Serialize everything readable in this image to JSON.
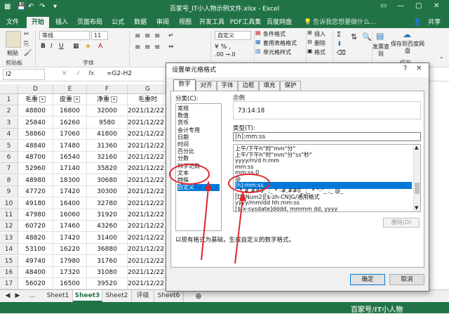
{
  "titlebar": {
    "title": "百家号_IT小人物示例文件.xlsx - Excel"
  },
  "ribbon_tabs": [
    "文件",
    "开始",
    "插入",
    "页面布局",
    "公式",
    "数据",
    "审阅",
    "视图",
    "开发工具",
    "PDF工具集",
    "百度网盘"
  ],
  "ribbon_search": "告诉我您想要做什么...",
  "ribbon_share": "共享",
  "ribbon": {
    "paste": "粘贴",
    "clipboard": "剪贴板",
    "font_name": "等线",
    "font_size": "11",
    "font_group": "字体",
    "number_format": "自定义",
    "cond_format": "条件格式",
    "table_format": "套用表格格式",
    "cell_style": "单元格样式",
    "insert": "插入",
    "delete": "删除",
    "format": "格式",
    "invoice": "发票查验",
    "save_baidu": "保存到百度网盘",
    "save_group": "保存"
  },
  "formula_bar": {
    "namebox": "I2",
    "formula": "=G2-H2"
  },
  "grid": {
    "columns": [
      "D",
      "E",
      "F",
      "G"
    ],
    "headers": [
      "毛重",
      "皮重",
      "净重",
      "毛重时"
    ],
    "rows": [
      {
        "n": "1"
      },
      {
        "n": "2",
        "d": "48800",
        "e": "16800",
        "f": "32000",
        "g": "2021/12/22 0"
      },
      {
        "n": "3",
        "d": "25840",
        "e": "16260",
        "f": "9580",
        "g": "2021/12/22 0"
      },
      {
        "n": "4",
        "d": "58860",
        "e": "17060",
        "f": "41800",
        "g": "2021/12/22 0"
      },
      {
        "n": "5",
        "d": "48840",
        "e": "17480",
        "f": "31360",
        "g": "2021/12/22 0"
      },
      {
        "n": "6",
        "d": "48700",
        "e": "16540",
        "f": "32160",
        "g": "2021/12/22 0"
      },
      {
        "n": "7",
        "d": "52960",
        "e": "17140",
        "f": "35820",
        "g": "2021/12/22 0"
      },
      {
        "n": "8",
        "d": "48980",
        "e": "18300",
        "f": "30680",
        "g": "2021/12/22 0"
      },
      {
        "n": "9",
        "d": "47720",
        "e": "17420",
        "f": "30300",
        "g": "2021/12/22 0"
      },
      {
        "n": "10",
        "d": "49180",
        "e": "16400",
        "f": "32780",
        "g": "2021/12/22 0"
      },
      {
        "n": "11",
        "d": "47980",
        "e": "16060",
        "f": "31920",
        "g": "2021/12/22 0"
      },
      {
        "n": "12",
        "d": "60720",
        "e": "17460",
        "f": "43260",
        "g": "2021/12/22 0"
      },
      {
        "n": "13",
        "d": "48820",
        "e": "17420",
        "f": "31400",
        "g": "2021/12/22 0"
      },
      {
        "n": "14",
        "d": "53100",
        "e": "16220",
        "f": "36880",
        "g": "2021/12/22 0"
      },
      {
        "n": "15",
        "d": "49740",
        "e": "17980",
        "f": "31760",
        "g": "2021/12/22 0"
      },
      {
        "n": "16",
        "d": "48400",
        "e": "17320",
        "f": "31080",
        "g": "2021/12/22 0"
      },
      {
        "n": "17",
        "d": "56020",
        "e": "16500",
        "f": "39520",
        "g": "2021/12/22 0"
      }
    ]
  },
  "sheet_tabs": [
    "Sheet1",
    "Sheet3",
    "Sheet2",
    "评级",
    "Sheet6"
  ],
  "sheet_tab_active": "Sheet3",
  "dialog": {
    "title": "设置单元格格式",
    "tabs": [
      "数字",
      "对齐",
      "字体",
      "边框",
      "填充",
      "保护"
    ],
    "category_label": "分类(C):",
    "categories": [
      "常规",
      "数值",
      "货币",
      "会计专用",
      "日期",
      "时间",
      "百分比",
      "分数",
      "科学记数",
      "文本",
      "特殊",
      "自定义"
    ],
    "selected_category": "自定义",
    "sample_label": "示例",
    "sample_value": "73:14:18",
    "type_label": "类型(T):",
    "type_value": "[h]:mm:ss",
    "type_list": [
      "上午/下午h\"时\"mm\"分\"",
      "上午/下午h\"时\"mm\"分\"ss\"秒\"",
      "yyyy/m/d h:mm",
      "mm:ss",
      "mm:ss.0",
      "@",
      "[h]:mm:ss",
      "_ * #,##0_ ;_ * -#,##0_ ;_ * \"-\"_ ;_ @_",
      "[DBNum2][$-zh-CN]G/通用格式",
      "yyyy/mm/dd hh:mm:ss",
      "[$-x-sysdate]dddd, mmmm dd, yyyy"
    ],
    "selected_type": "[h]:mm:ss",
    "delete_button": "删除(D)",
    "description": "以现有格式为基础，生成自定义的数字格式。",
    "ok": "确定",
    "cancel": "取消"
  },
  "watermark": "百家号/IT小人物",
  "colors": {
    "excel_green": "#217346",
    "selection_blue": "#0078d7",
    "annotation_red": "#e0262b"
  }
}
